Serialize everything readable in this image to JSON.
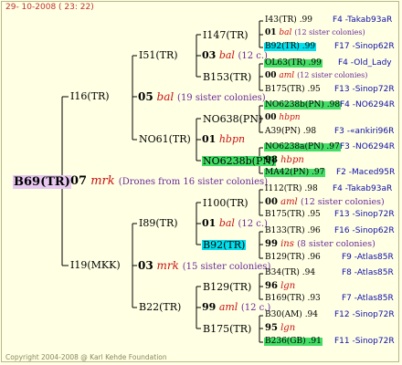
{
  "date": "29- 10-2008 ( 23: 22)",
  "copyright": "Copyright 2004-2008 @ Karl Kehde Foundation",
  "root": {
    "label": "B69(TR)",
    "qnum": "07",
    "qname": "mrk",
    "note": "(Drones from 16 sister colonies)"
  },
  "g1": {
    "a": {
      "label": "I16(TR)",
      "qnum": "05",
      "qname": "bal",
      "note": "(19 sister colonies)"
    },
    "b": {
      "label": "I19(MKK)",
      "qnum": "03",
      "qname": "mrk",
      "note": "(15 sister colonies)"
    }
  },
  "g2": {
    "a": {
      "label": "I51(TR)",
      "qnum": "03",
      "qname": "bal",
      "note": "(12 c.)"
    },
    "b": {
      "label": "NO61(TR)",
      "qnum": "01",
      "qname": "hbpn"
    },
    "c": {
      "label": "I89(TR)",
      "qnum": "01",
      "qname": "bal",
      "note": "(12 c.)"
    },
    "d": {
      "label": "B22(TR)",
      "qnum": "99",
      "qname": "aml",
      "note": "(12 c.)"
    }
  },
  "g3": {
    "a": {
      "label": "I147(TR)"
    },
    "b": {
      "label": "B153(TR)"
    },
    "c": {
      "label": "NO638(PN)"
    },
    "d": {
      "label": "NO6238b(PN)",
      "qnum": "98",
      "qname": "hbpn"
    },
    "e": {
      "label": "I100(TR)",
      "qnum": "00",
      "qname": "aml",
      "note": "(12 sister colonies)"
    },
    "f": {
      "label": "B92(TR)",
      "qnum": "99",
      "qname": "ins",
      "note": "(8 sister colonies)"
    },
    "g": {
      "label": "B129(TR)",
      "qnum": "96",
      "qname": "lgn"
    },
    "h": {
      "label": "B175(TR)",
      "qnum": "95",
      "qname": "lgn"
    }
  },
  "g4": [
    {
      "label": "I43(TR)",
      "num": ".99",
      "loc": "F4 -Takab93aR"
    },
    {
      "qnum": "01",
      "qname": "bal",
      "note": "(12 sister colonies)"
    },
    {
      "label": "B92(TR)",
      "num": ".99",
      "loc": "F17 -Sinop62R"
    },
    {
      "label": "OL63(TR)",
      "num": ".99",
      "loc": "F4 -Old_Lady"
    },
    {
      "qnum": "00",
      "qname": "aml",
      "note": "(12 sister colonies)"
    },
    {
      "label": "B175(TR)",
      "num": ".95",
      "loc": "F13 -Sinop72R"
    },
    {
      "label": "NO6238b(PN)",
      "num": ".98",
      "loc": "F4 -NO6294R"
    },
    {
      "qnum": "00",
      "qname": "hbpn"
    },
    {
      "label": "A39(PN)",
      "num": ".98",
      "loc": "F3 -«ankiri96R"
    },
    {
      "label": "NO6238a(PN)",
      "num": ".97",
      "loc": "F3 -NO6294R"
    },
    {
      "qnum": "00",
      "qname": "hbpn"
    },
    {
      "label": "MA42(PN)",
      "num": ".97",
      "loc": "F2 -Maced95R"
    },
    {
      "label": "I112(TR)",
      "num": ".98",
      "loc": "F4 -Takab93aR"
    },
    {
      "label": "B175(TR)",
      "num": ".95",
      "loc": "F13 -Sinop72R"
    },
    {
      "label": "B133(TR)",
      "num": ".96",
      "loc": "F16 -Sinop62R"
    },
    {
      "label": "B129(TR)",
      "num": ".96",
      "loc": "F9 -Atlas85R"
    },
    {
      "label": "B34(TR)",
      "num": ".94",
      "loc": "F8 -Atlas85R"
    },
    {
      "label": "B169(TR)",
      "num": ".93",
      "loc": "F7 -Atlas85R"
    },
    {
      "label": "B30(AM)",
      "num": ".94",
      "loc": "F12 -Sinop72R"
    },
    {
      "label": "B236(GB)",
      "num": ".91",
      "loc": "F11 -Sinop72R"
    }
  ]
}
